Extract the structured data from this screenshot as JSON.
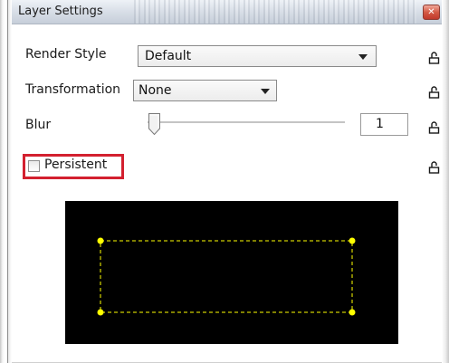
{
  "window": {
    "title": "Layer Settings",
    "close_glyph": "✕",
    "close_color": "#c0392b"
  },
  "render_style": {
    "label": "Render Style",
    "value": "Default"
  },
  "transformation": {
    "label": "Transformation",
    "value": "None"
  },
  "blur": {
    "label": "Blur",
    "value": "1"
  },
  "persistent": {
    "label": "Persistent",
    "checked": false,
    "highlight_color": "#d3202f"
  },
  "preview": {
    "background": "#000000",
    "handle_color": "#ffff00",
    "dash_color": "#ffff00"
  },
  "icons": {
    "lock": "lock-icon"
  }
}
